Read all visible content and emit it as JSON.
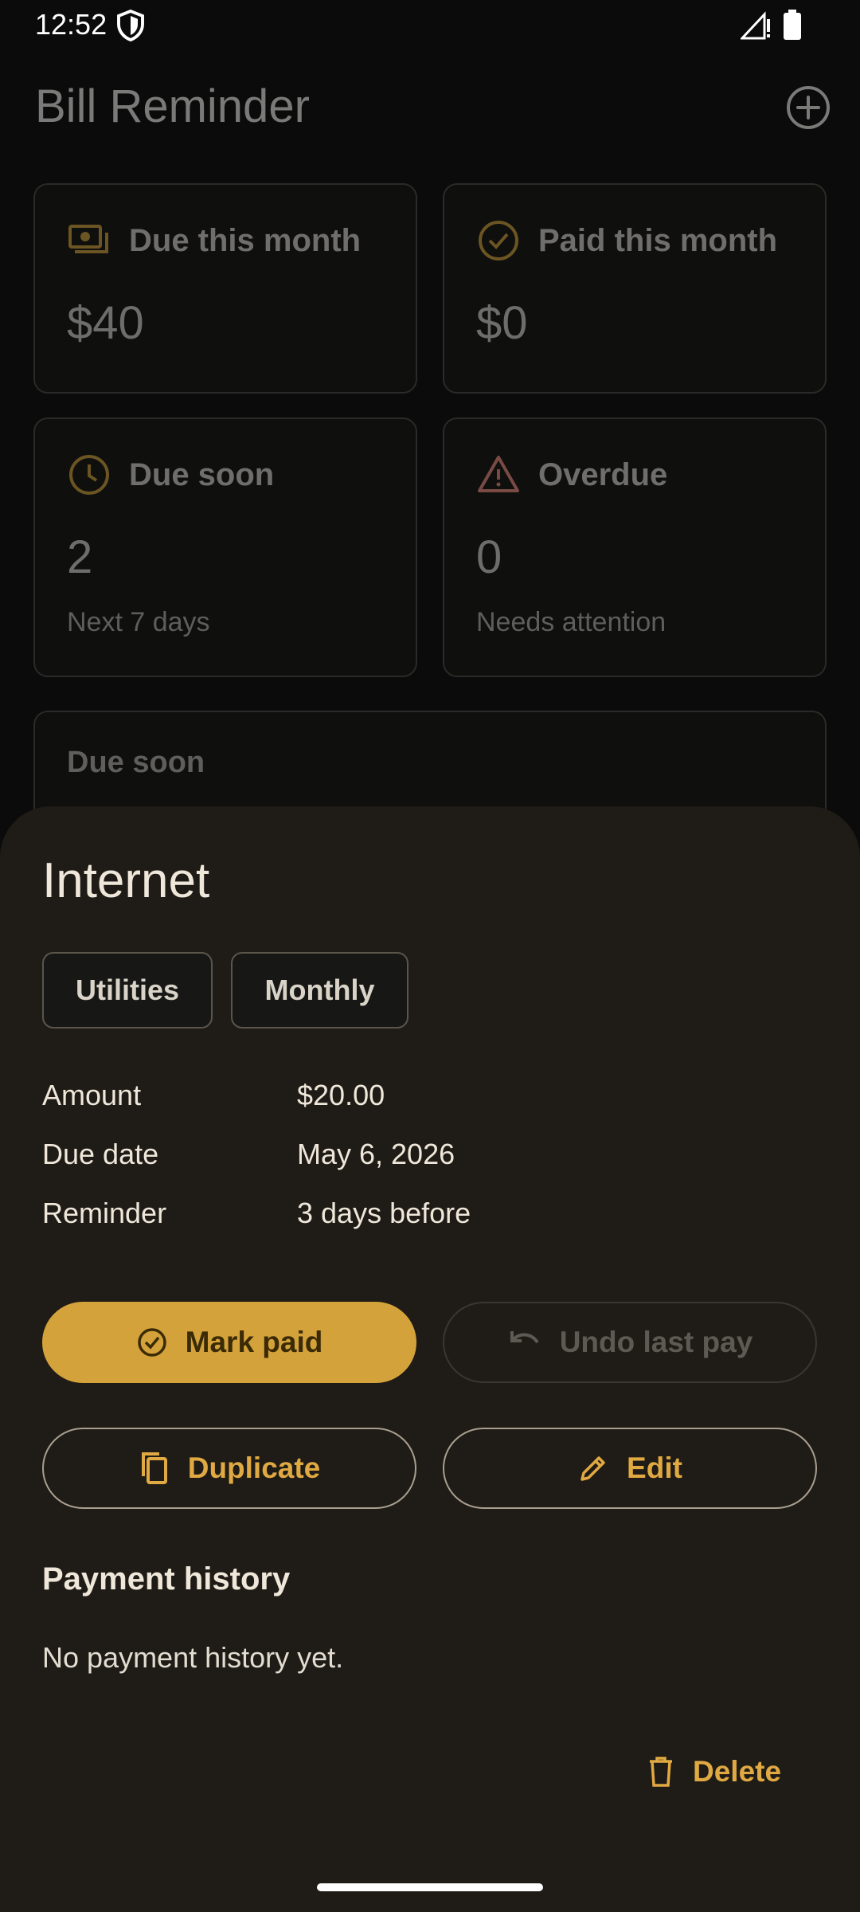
{
  "status_bar": {
    "time": "12:52"
  },
  "app": {
    "title": "Bill Reminder"
  },
  "cards": [
    {
      "label": "Due this month",
      "value": "$40",
      "sub": "",
      "icon": "payments-icon"
    },
    {
      "label": "Paid this month",
      "value": "$0",
      "sub": "",
      "icon": "check-circle-icon"
    },
    {
      "label": "Due soon",
      "value": "2",
      "sub": "Next 7 days",
      "icon": "clock-icon"
    },
    {
      "label": "Overdue",
      "value": "0",
      "sub": "Needs attention",
      "icon": "warning-icon"
    }
  ],
  "due_soon_section": {
    "title": "Due soon"
  },
  "sheet": {
    "title": "Internet",
    "chips": [
      "Utilities",
      "Monthly"
    ],
    "details": [
      {
        "label": "Amount",
        "value": "$20.00"
      },
      {
        "label": "Due date",
        "value": "May 6, 2026"
      },
      {
        "label": "Reminder",
        "value": "3 days before"
      }
    ],
    "buttons": {
      "mark_paid": "Mark paid",
      "undo": "Undo last pay",
      "duplicate": "Duplicate",
      "edit": "Edit",
      "delete": "Delete"
    },
    "payment_history": {
      "title": "Payment history",
      "empty": "No payment history yet."
    }
  },
  "colors": {
    "accent": "#d4a23a",
    "sheet_bg": "#1f1b16",
    "warning": "#7a4a44"
  }
}
